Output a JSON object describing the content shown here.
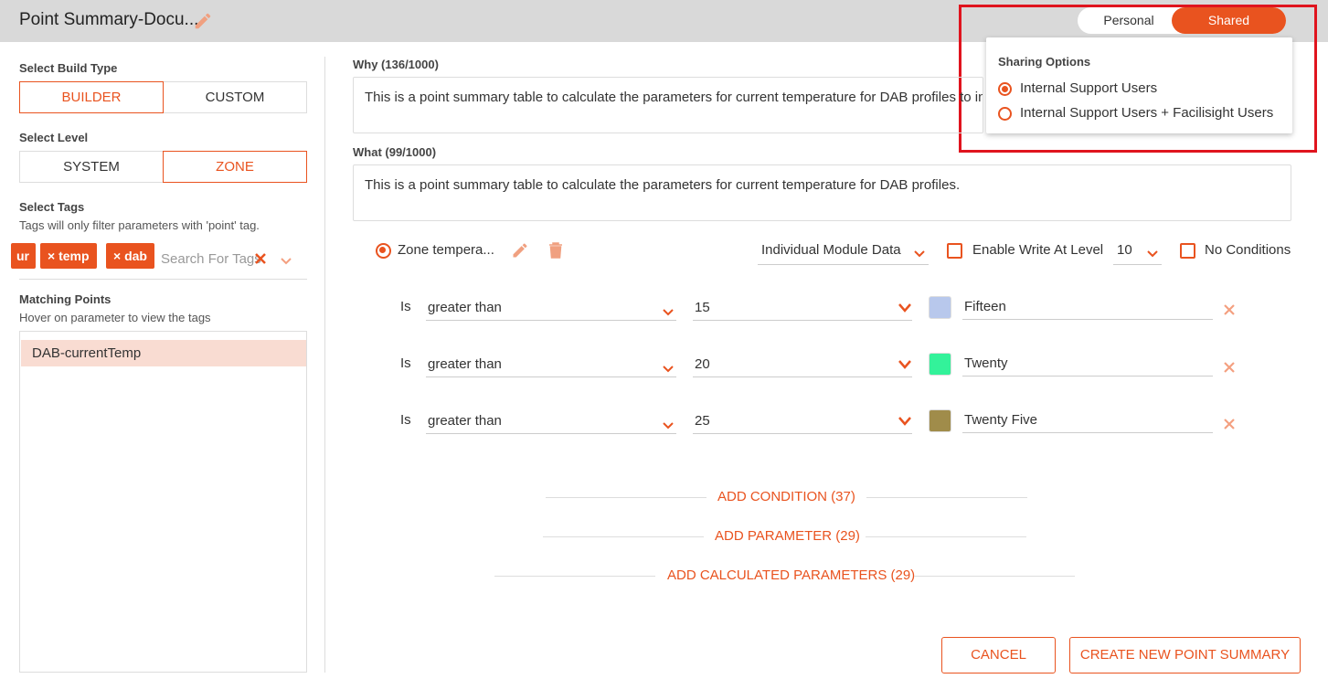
{
  "header": {
    "title": "Point Summary-Docu...",
    "toggle": {
      "personal": "Personal",
      "shared": "Shared"
    },
    "sharing": {
      "title": "Sharing Options",
      "options": [
        "Internal Support Users",
        "Internal Support Users + Facilisight Users"
      ],
      "selected_index": 0
    }
  },
  "sidebar": {
    "build_type": {
      "label": "Select Build Type",
      "builder": "BUILDER",
      "custom": "CUSTOM",
      "active": "BUILDER"
    },
    "level": {
      "label": "Select Level",
      "system": "SYSTEM",
      "zone": "ZONE",
      "active": "ZONE"
    },
    "tags": {
      "label": "Select Tags",
      "hint": "Tags will only filter parameters with 'point' tag.",
      "chips": [
        "ur",
        "temp",
        "dab"
      ],
      "chip_x_prefix": "×",
      "placeholder": "Search For Tags"
    },
    "matching": {
      "label": "Matching Points",
      "hint": "Hover on parameter to view the tags",
      "items": [
        "DAB-currentTemp"
      ]
    }
  },
  "main": {
    "why": {
      "label": "Why (136/1000)",
      "value": "This is a point summary table to calculate the parameters for current temperature for DAB profiles to inge"
    },
    "what": {
      "label": "What (99/1000)",
      "value": "This is a point summary table to calculate the parameters for current temperature for DAB profiles."
    },
    "parameter": {
      "name": "Zone tempera...",
      "data_source": "Individual Module Data",
      "enable_write_label": "Enable Write At Level",
      "write_level": "10",
      "no_conditions_label": "No Conditions"
    },
    "conditions": [
      {
        "prefix": "Is",
        "operator": "greater than",
        "value": "15",
        "color": "#b8c8ec",
        "label": "Fifteen"
      },
      {
        "prefix": "Is",
        "operator": "greater than",
        "value": "20",
        "color": "#33f29a",
        "label": "Twenty"
      },
      {
        "prefix": "Is",
        "operator": "greater than",
        "value": "25",
        "color": "#a08c4a",
        "label": "Twenty Five"
      }
    ],
    "links": {
      "add_condition": "ADD CONDITION (37)",
      "add_parameter": "ADD PARAMETER (29)",
      "add_calculated": "ADD CALCULATED PARAMETERS (29)"
    },
    "buttons": {
      "cancel": "CANCEL",
      "create": "CREATE NEW POINT SUMMARY"
    }
  },
  "colors": {
    "accent": "#e9531f",
    "highlight": "#e0141e"
  }
}
